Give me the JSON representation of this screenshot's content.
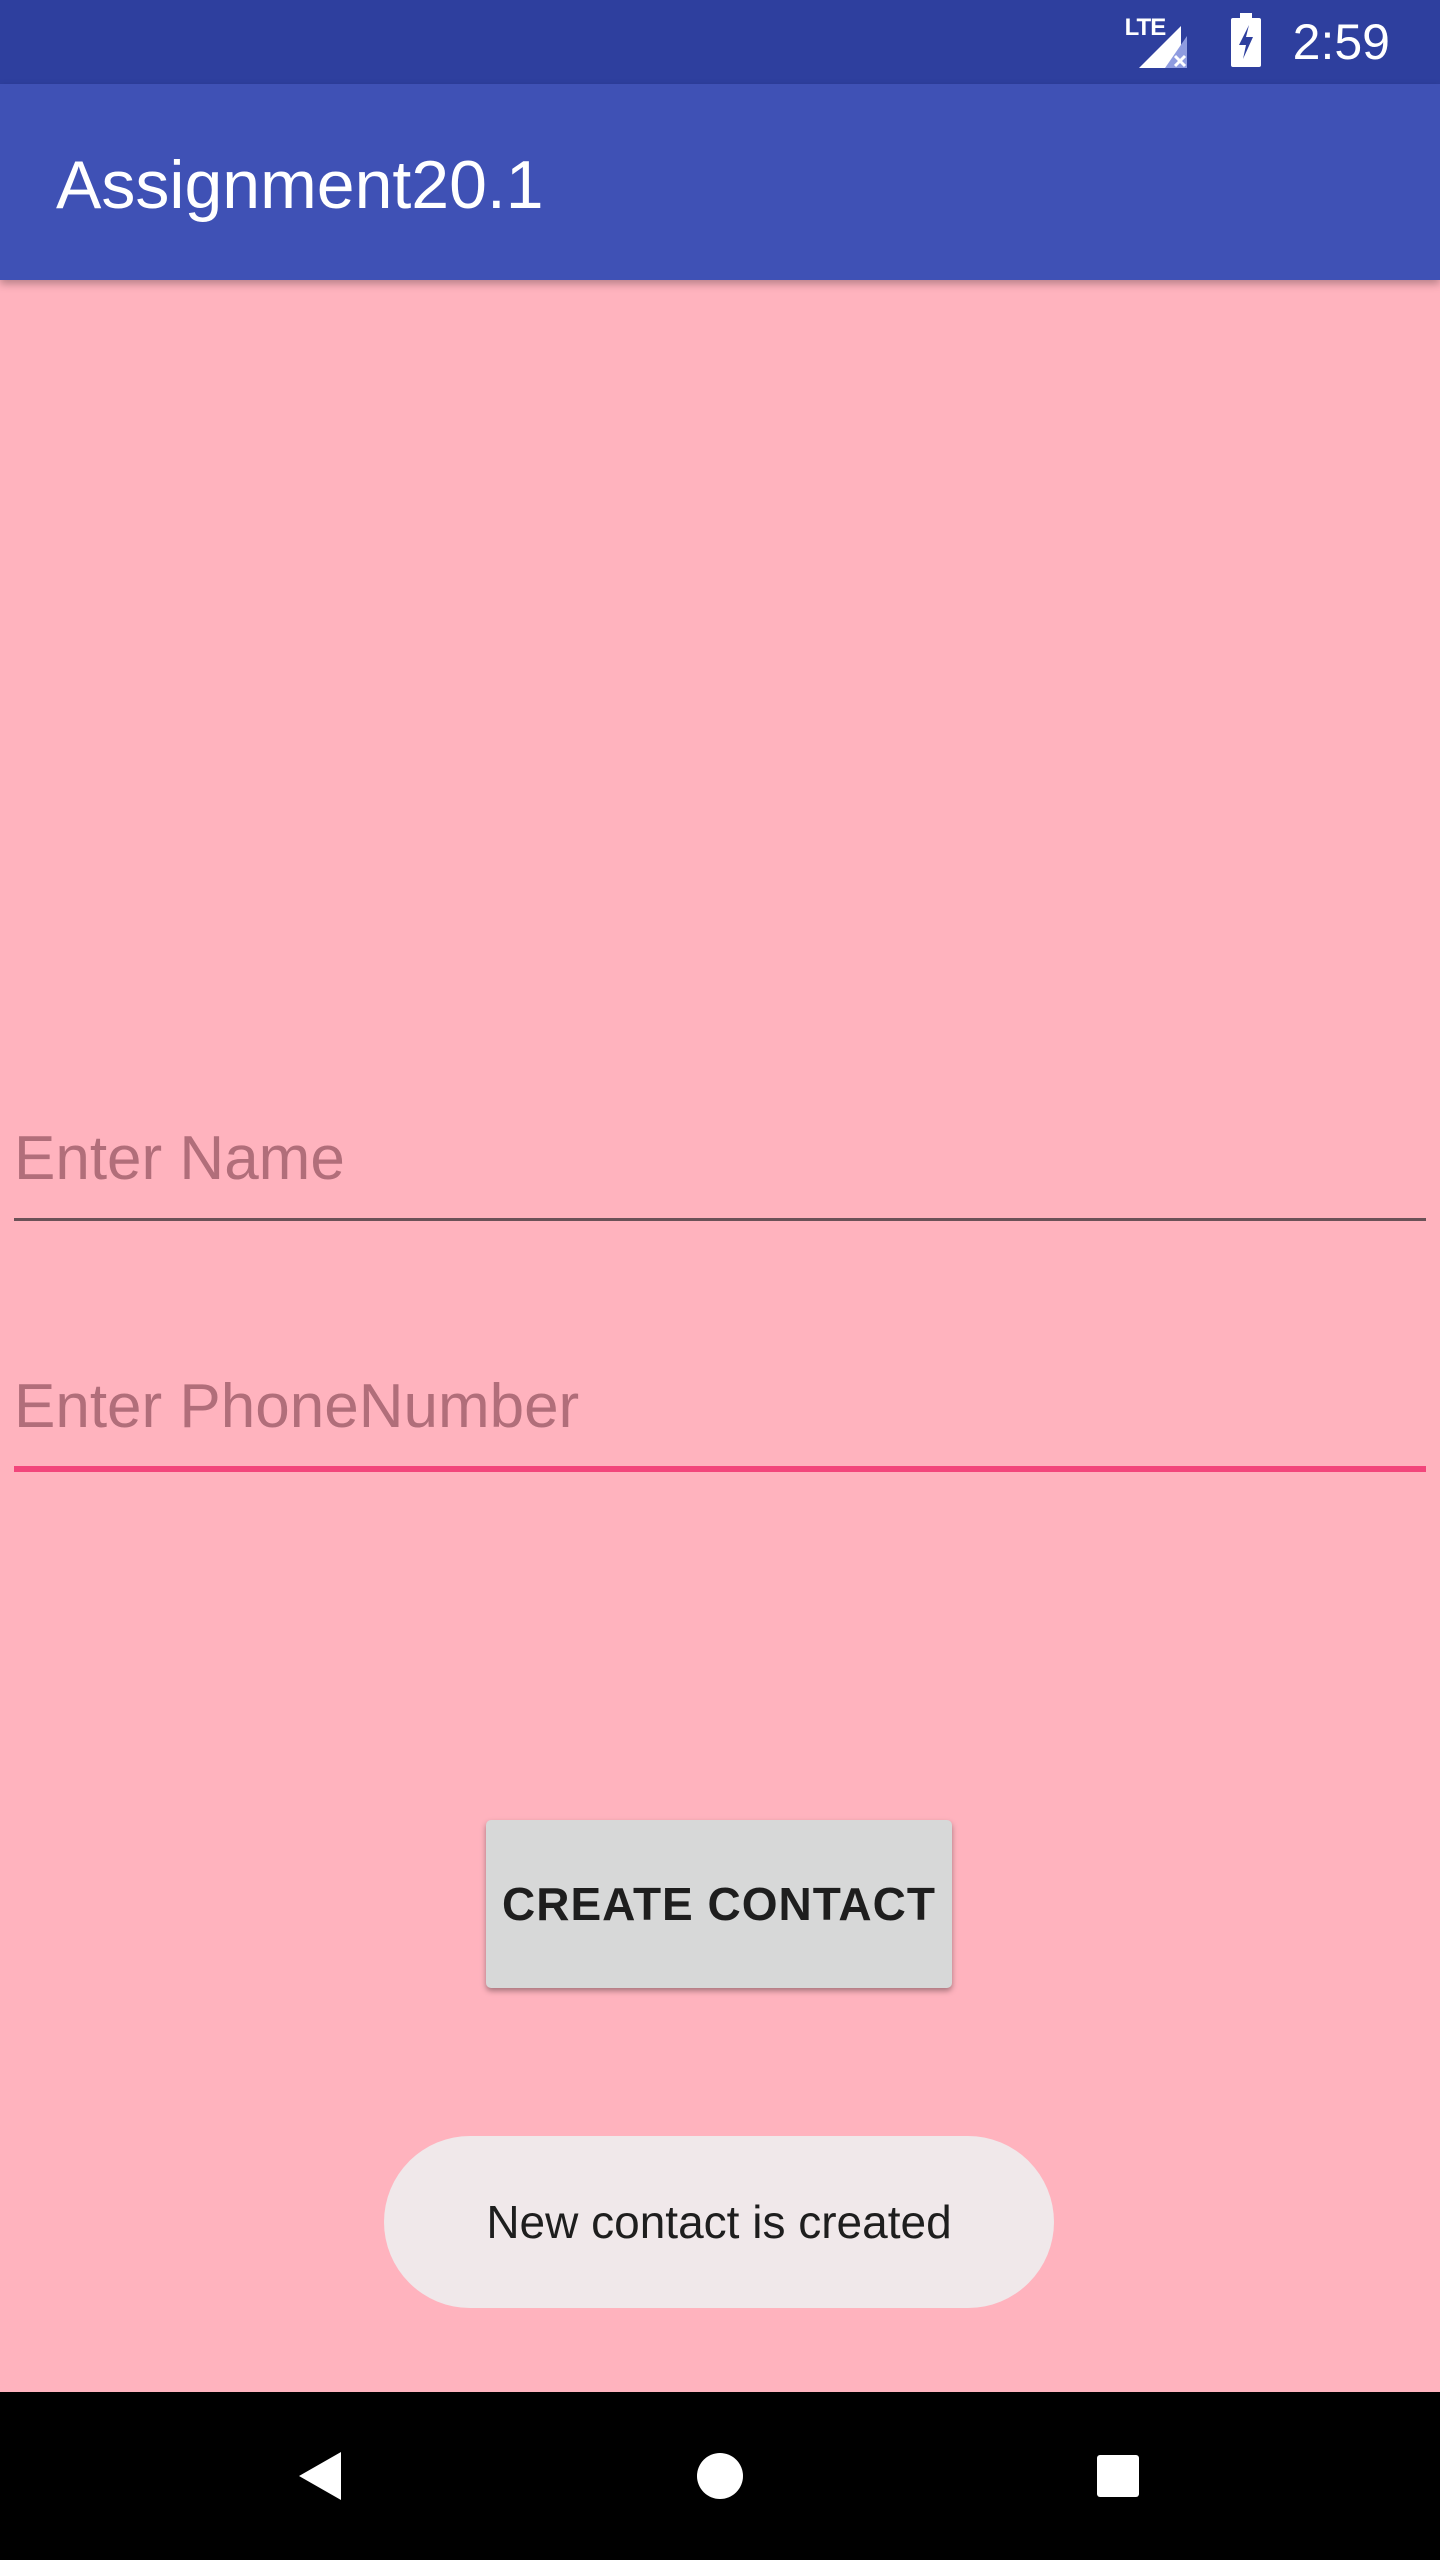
{
  "status_bar": {
    "network_label": "LTE",
    "time": "2:59",
    "icons": [
      "lte-signal-icon",
      "battery-charging-icon"
    ]
  },
  "app_bar": {
    "title": "Assignment20.1",
    "color": "#3F51B5"
  },
  "form": {
    "name_field": {
      "placeholder": "Enter Name",
      "value": ""
    },
    "phone_field": {
      "placeholder": "Enter PhoneNumber",
      "value": "",
      "focused": true
    },
    "create_button_label": "CREATE CONTACT"
  },
  "toast": {
    "message": "New contact is created"
  },
  "nav_bar": {
    "icons": [
      "back-icon",
      "home-icon",
      "recents-icon"
    ]
  },
  "colors": {
    "background": "#FFB3BE",
    "status_bar": "#2E3F9E",
    "accent": "#F2467B"
  }
}
